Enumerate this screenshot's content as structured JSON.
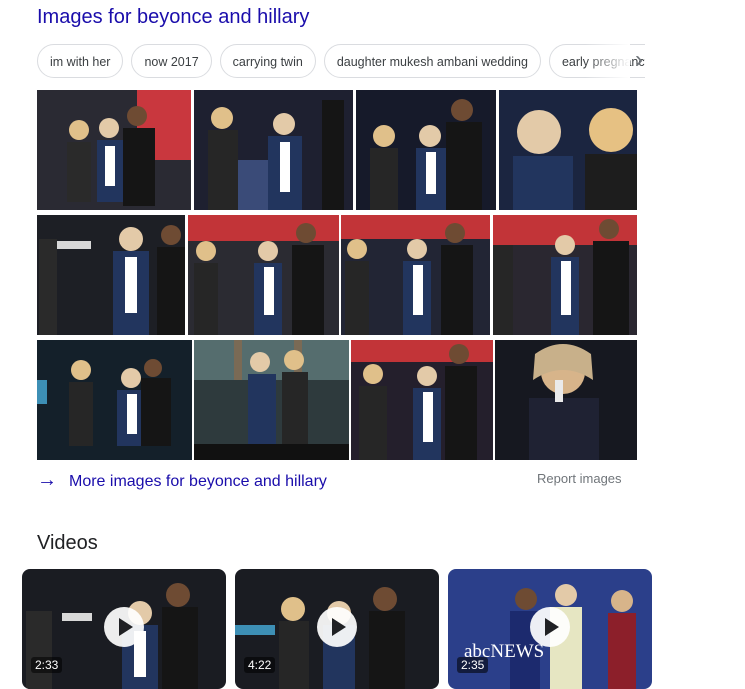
{
  "images_section": {
    "title": "Images for beyonce and hillary",
    "chips": [
      "im with her",
      "now 2017",
      "carrying twin",
      "daughter mukesh ambani wedding",
      "early pregnancy"
    ],
    "next_icon": "chevron-right-icon",
    "rows": [
      [
        {
          "bg": "#2a2a33",
          "accent": "#c9373e"
        },
        {
          "bg": "#1e2030",
          "accent": "#3a4b78"
        },
        {
          "bg": "#161a2a",
          "accent": "#2c3e6a"
        },
        {
          "bg": "#1b2540",
          "accent": "#9e7a44"
        }
      ],
      [
        {
          "bg": "#1d1f25",
          "accent": "#d8d8d8"
        },
        {
          "bg": "#2b2b32",
          "accent": "#c23438"
        },
        {
          "bg": "#222534",
          "accent": "#c23438"
        },
        {
          "bg": "#2a2730",
          "accent": "#c23438"
        }
      ],
      [
        {
          "bg": "#14202a",
          "accent": "#3d8fb5"
        },
        {
          "bg": "#2e3a3d",
          "accent": "#556d6e"
        },
        {
          "bg": "#241f2c",
          "accent": "#c23438"
        },
        {
          "bg": "#161820",
          "accent": "#c8b08a"
        }
      ]
    ],
    "more_label": "More images for beyonce and hillary",
    "more_icon": "arrow-right-icon",
    "report_label": "Report images"
  },
  "videos_section": {
    "title": "Videos",
    "items": [
      {
        "duration": "2:33",
        "bg": "#1a1c22"
      },
      {
        "duration": "4:22",
        "bg": "#1a1c22"
      },
      {
        "duration": "2:35",
        "bg": "#2b3f8a",
        "logo_text": "abcNEWS"
      }
    ],
    "play_icon": "play-icon"
  }
}
